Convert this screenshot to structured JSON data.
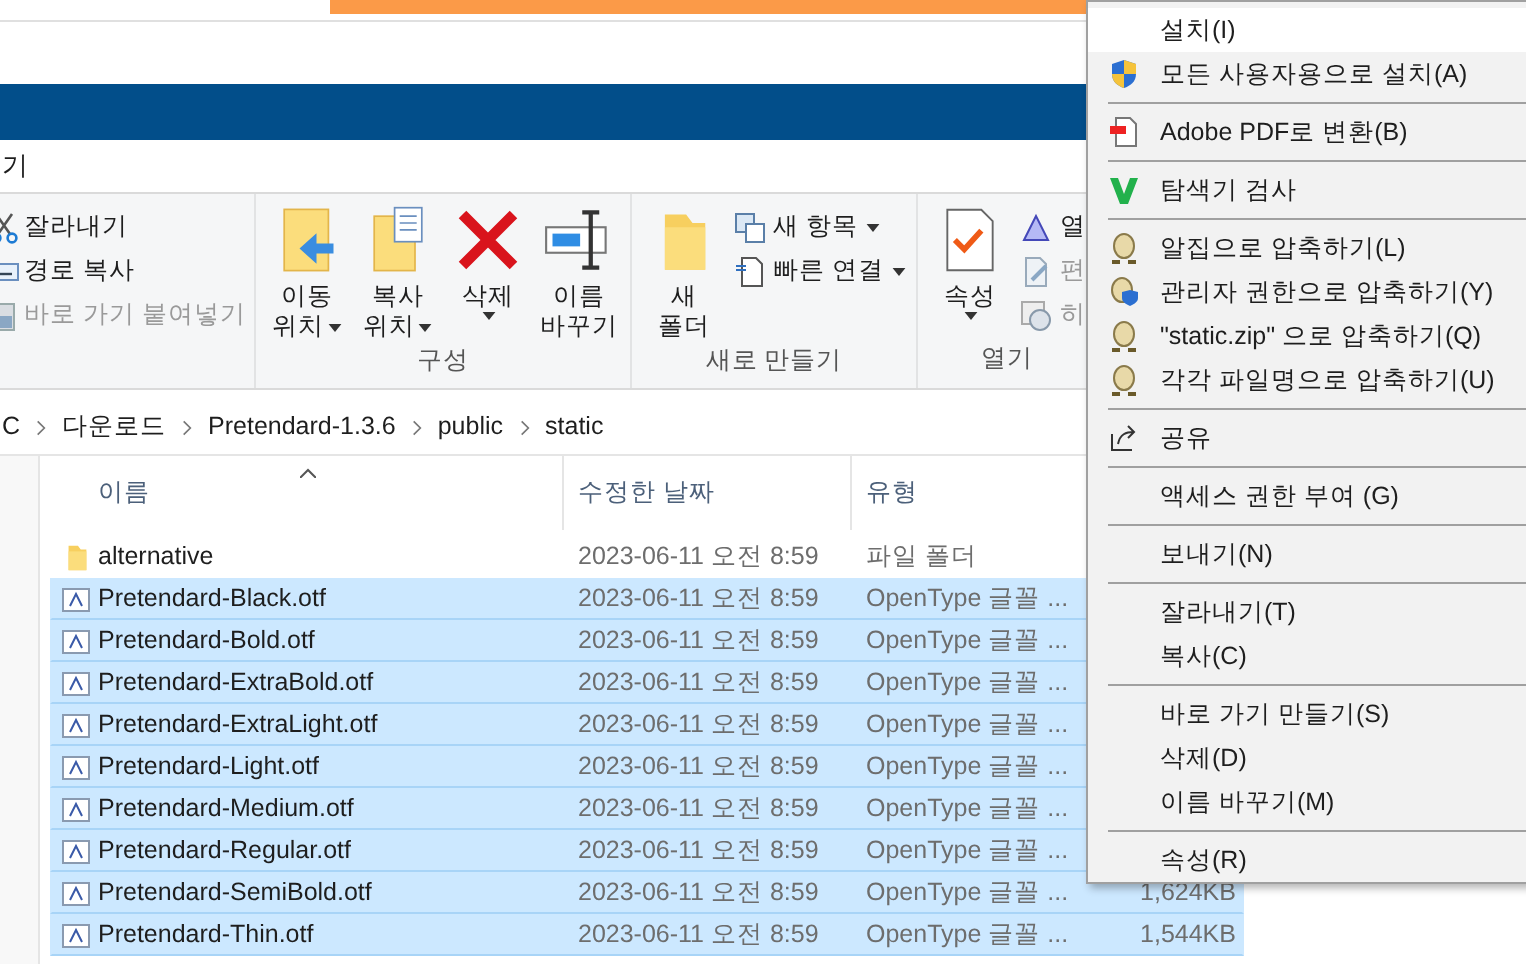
{
  "tab_label": "기",
  "ribbon": {
    "clipboard": [
      {
        "label": "잘라내기",
        "disabled": false
      },
      {
        "label": "경로 복사",
        "disabled": false
      },
      {
        "label": "바로 가기 붙여넣기",
        "disabled": true
      }
    ],
    "groups": [
      {
        "label": "구성",
        "buttons": [
          {
            "lines": [
              "이동",
              "위치"
            ],
            "dropdown": true
          },
          {
            "lines": [
              "복사",
              "위치"
            ],
            "dropdown": true
          },
          {
            "lines": [
              "삭제"
            ],
            "dropdown": true
          },
          {
            "lines": [
              "이름",
              "바꾸기"
            ],
            "dropdown": false
          }
        ]
      },
      {
        "label": "새로 만들기",
        "buttons": [
          {
            "lines": [
              "새",
              "폴더"
            ],
            "dropdown": false
          }
        ],
        "small": [
          {
            "label": "새 항목",
            "dropdown": true,
            "disabled": false
          },
          {
            "label": "빠른 연결",
            "dropdown": true,
            "disabled": false
          }
        ]
      },
      {
        "label": "열기",
        "buttons": [
          {
            "lines": [
              "속성"
            ],
            "dropdown": true
          }
        ],
        "small": [
          {
            "label": "열",
            "dropdown": false,
            "disabled": false
          },
          {
            "label": "편",
            "dropdown": false,
            "disabled": true
          },
          {
            "label": "히",
            "dropdown": false,
            "disabled": true
          }
        ]
      }
    ]
  },
  "breadcrumb": [
    "C",
    "다운로드",
    "Pretendard-1.3.6",
    "public",
    "static"
  ],
  "columns": [
    "이름",
    "수정한 날짜",
    "유형"
  ],
  "rows": [
    {
      "kind": "folder",
      "name": "alternative",
      "date": "2023-06-11 오전 8:59",
      "type": "파일 폴더",
      "selected": false
    },
    {
      "kind": "font",
      "name": "Pretendard-Black.otf",
      "date": "2023-06-11 오전 8:59",
      "type": "OpenType 글꼴 ...",
      "selected": true
    },
    {
      "kind": "font",
      "name": "Pretendard-Bold.otf",
      "date": "2023-06-11 오전 8:59",
      "type": "OpenType 글꼴 ...",
      "selected": true
    },
    {
      "kind": "font",
      "name": "Pretendard-ExtraBold.otf",
      "date": "2023-06-11 오전 8:59",
      "type": "OpenType 글꼴 ...",
      "selected": true
    },
    {
      "kind": "font",
      "name": "Pretendard-ExtraLight.otf",
      "date": "2023-06-11 오전 8:59",
      "type": "OpenType 글꼴 ...",
      "selected": true
    },
    {
      "kind": "font",
      "name": "Pretendard-Light.otf",
      "date": "2023-06-11 오전 8:59",
      "type": "OpenType 글꼴 ...",
      "selected": true
    },
    {
      "kind": "font",
      "name": "Pretendard-Medium.otf",
      "date": "2023-06-11 오전 8:59",
      "type": "OpenType 글꼴 ...",
      "selected": true
    },
    {
      "kind": "font",
      "name": "Pretendard-Regular.otf",
      "date": "2023-06-11 오전 8:59",
      "type": "OpenType 글꼴 ...",
      "selected": true
    },
    {
      "kind": "font",
      "name": "Pretendard-SemiBold.otf",
      "date": "2023-06-11 오전 8:59",
      "type": "OpenType 글꼴 ...",
      "size": "1,624KB",
      "selected": true
    },
    {
      "kind": "font",
      "name": "Pretendard-Thin.otf",
      "date": "2023-06-11 오전 8:59",
      "type": "OpenType 글꼴 ...",
      "size": "1,544KB",
      "selected": true
    }
  ],
  "context_menu": [
    {
      "kind": "item",
      "label": "설치(I)",
      "selected": true
    },
    {
      "kind": "item",
      "label": "모든 사용자용으로 설치(A)",
      "selected": false
    },
    {
      "kind": "separator"
    },
    {
      "kind": "item",
      "label": "Adobe PDF로 변환(B)",
      "selected": false
    },
    {
      "kind": "separator"
    },
    {
      "kind": "item",
      "label": "탐색기 검사",
      "selected": false
    },
    {
      "kind": "separator"
    },
    {
      "kind": "item",
      "label": "알집으로 압축하기(L)",
      "selected": false
    },
    {
      "kind": "item",
      "label": "관리자 권한으로 압축하기(Y)",
      "selected": false
    },
    {
      "kind": "item",
      "label": "\"static.zip\" 으로 압축하기(Q)",
      "selected": false
    },
    {
      "kind": "item",
      "label": "각각 파일명으로 압축하기(U)",
      "selected": false
    },
    {
      "kind": "separator"
    },
    {
      "kind": "item",
      "label": "공유",
      "selected": false
    },
    {
      "kind": "separator"
    },
    {
      "kind": "item",
      "label": "액세스 권한 부여 (G)",
      "selected": false
    },
    {
      "kind": "separator"
    },
    {
      "kind": "item",
      "label": "보내기(N)",
      "selected": false
    },
    {
      "kind": "separator"
    },
    {
      "kind": "item",
      "label": "잘라내기(T)",
      "selected": false
    },
    {
      "kind": "item",
      "label": "복사(C)",
      "selected": false
    },
    {
      "kind": "separator"
    },
    {
      "kind": "item",
      "label": "바로 가기 만들기(S)",
      "selected": false
    },
    {
      "kind": "item",
      "label": "삭제(D)",
      "selected": false
    },
    {
      "kind": "item",
      "label": "이름 바꾸기(M)",
      "selected": false
    },
    {
      "kind": "separator"
    },
    {
      "kind": "item",
      "label": "속성(R)",
      "selected": false
    }
  ]
}
